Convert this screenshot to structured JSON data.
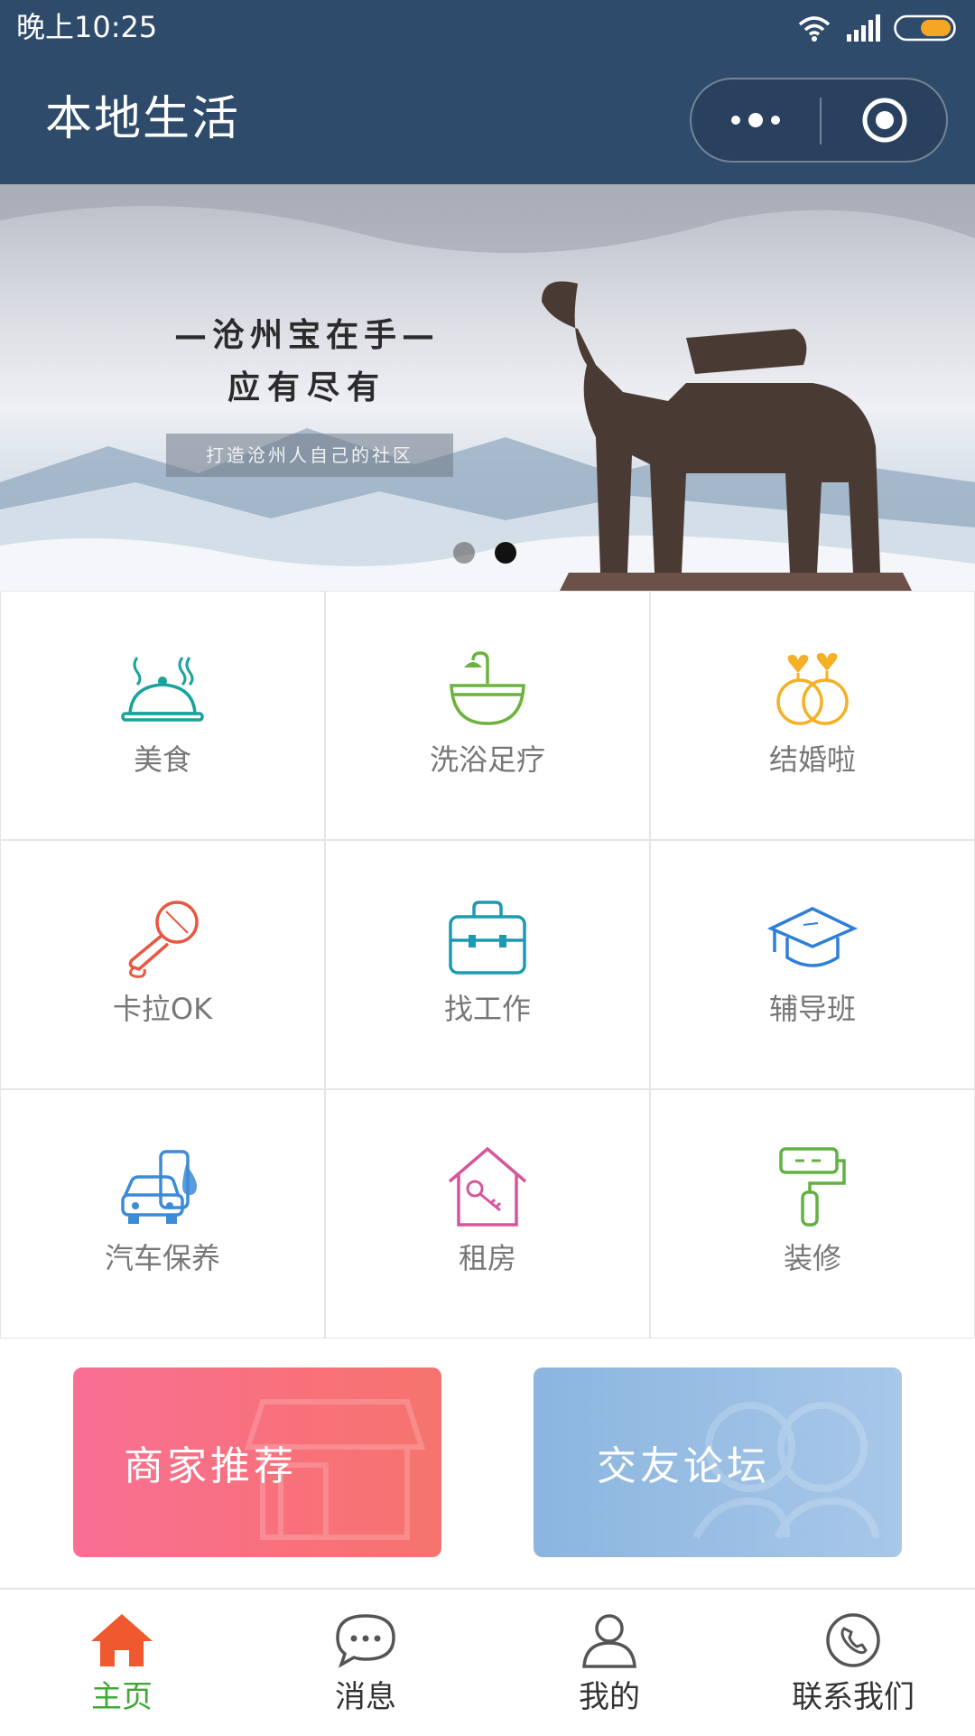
{
  "status_bar": {
    "time": "晚上10:25"
  },
  "nav": {
    "title": "本地生活",
    "more_icon": "more-dots-icon",
    "close_icon": "target-circle-icon"
  },
  "banner": {
    "slogan_line1": "—沧州宝在手—",
    "slogan_line2": "应有尽有",
    "tagline": "打造沧州人自己的社区",
    "slide_count": 2,
    "active_slide": 2
  },
  "categories": [
    {
      "label": "美食",
      "icon": "food-cloche-icon",
      "color": "#1aa39a"
    },
    {
      "label": "洗浴足疗",
      "icon": "bath-tub-icon",
      "color": "#6cb33e"
    },
    {
      "label": "结婚啦",
      "icon": "wedding-rings-icon",
      "color": "#f5b026"
    },
    {
      "label": "卡拉OK",
      "icon": "microphone-icon",
      "color": "#e8573f"
    },
    {
      "label": "找工作",
      "icon": "briefcase-icon",
      "color": "#1b9bb1"
    },
    {
      "label": "辅导班",
      "icon": "graduation-cap-icon",
      "color": "#2f7ed8"
    },
    {
      "label": "汽车保养",
      "icon": "car-wash-icon",
      "color": "#3d8ad6"
    },
    {
      "label": "租房",
      "icon": "house-key-icon",
      "color": "#d6569b"
    },
    {
      "label": "装修",
      "icon": "paint-roller-icon",
      "color": "#62b043"
    }
  ],
  "promos": {
    "shop": {
      "label": "商家推荐"
    },
    "forum": {
      "label": "交友论坛"
    }
  },
  "tabbar": {
    "items": [
      {
        "label": "主页",
        "icon": "home-icon",
        "active": true
      },
      {
        "label": "消息",
        "icon": "chat-bubble-icon",
        "active": false
      },
      {
        "label": "我的",
        "icon": "user-icon",
        "active": false
      },
      {
        "label": "联系我们",
        "icon": "phone-icon",
        "active": false
      }
    ],
    "active_color": "#3fa83a",
    "active_icon_color": "#f0592f"
  }
}
